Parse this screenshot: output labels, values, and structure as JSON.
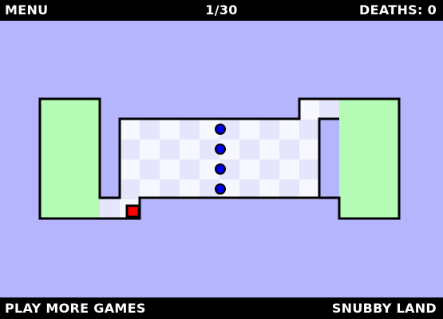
{
  "hud": {
    "menu_label": "MENU",
    "level": "1/30",
    "deaths": "DEATHS: 0"
  },
  "footer": {
    "play_more_label": "PLAY MORE GAMES",
    "brand_label": "SNUBBY LAND"
  },
  "level": {
    "enemy_count": 4,
    "colors": {
      "background": "#b4b5fc",
      "safe_zone": "#b5fbb5",
      "checker_light": "#f7f7ff",
      "checker_dark": "#e5e5fc",
      "enemy": "#0000ee",
      "player": "#ff0000"
    }
  }
}
